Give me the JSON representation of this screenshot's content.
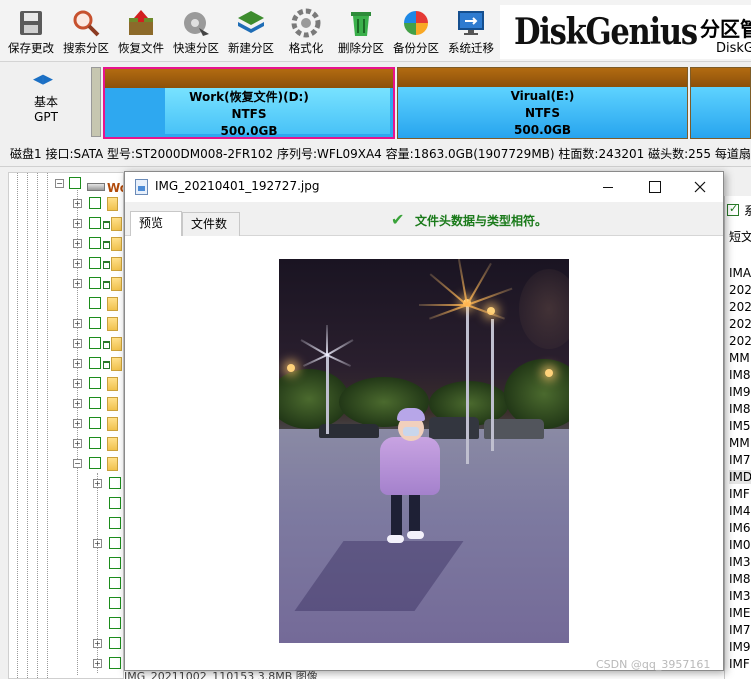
{
  "toolbar": {
    "buttons": [
      {
        "label": "保存更改",
        "icon": "save-disk-icon"
      },
      {
        "label": "搜索分区",
        "icon": "magnifier-icon"
      },
      {
        "label": "恢复文件",
        "icon": "recover-box-icon"
      },
      {
        "label": "快速分区",
        "icon": "quick-partition-disc-icon"
      },
      {
        "label": "新建分区",
        "icon": "new-partition-stack-icon"
      },
      {
        "label": "格式化",
        "icon": "format-gear-icon"
      },
      {
        "label": "删除分区",
        "icon": "delete-bin-icon"
      },
      {
        "label": "备份分区",
        "icon": "backup-pie-icon"
      },
      {
        "label": "系统迁移",
        "icon": "system-migrate-monitor-icon"
      }
    ],
    "brand": {
      "name": "DiskGenius",
      "title_cn": "分区管",
      "subtitle": "DiskG"
    }
  },
  "disk_map": {
    "label_line1": "基本",
    "label_line2": "GPT",
    "partitions": [
      {
        "name": "Work(恢复文件)(D:)",
        "fs": "NTFS",
        "size": "500.0GB",
        "selected": true
      },
      {
        "name": "Virual(E:)",
        "fs": "NTFS",
        "size": "500.0GB",
        "selected": false
      },
      {
        "name": "",
        "fs": "",
        "size": "",
        "selected": false
      }
    ]
  },
  "info_line": "磁盘1 接口:SATA  型号:ST2000DM008-2FR102  序列号:WFL09XA4  容量:1863.0GB(1907729MB)  柱面数:243201  磁头数:255  每道扇区",
  "tree": {
    "root_label": "Wo"
  },
  "file_list": {
    "check_label": "系",
    "short_label": "短文",
    "items": [
      "IMA",
      "202",
      "202",
      "202",
      "202",
      "MM",
      "IM8",
      "IM9",
      "IM8",
      "IM5",
      "MM",
      "IM7",
      "IMD",
      "IMF",
      "IM4",
      "IM6",
      "IM0",
      "IM3",
      "IM8",
      "IM3",
      "IME",
      "IM7",
      "IM9",
      "IMF"
    ]
  },
  "bottom_peek": "IMG_20211002_110153                 3.8MB  图像",
  "preview": {
    "title": "IMG_20210401_192727.jpg",
    "tabs": [
      "预览",
      "文件数据"
    ],
    "status": "文件头数据与类型相符。",
    "colors": {
      "status": "#1a7a1a",
      "check": "#3aa33a"
    }
  },
  "watermark": "CSDN @qq_3957161"
}
